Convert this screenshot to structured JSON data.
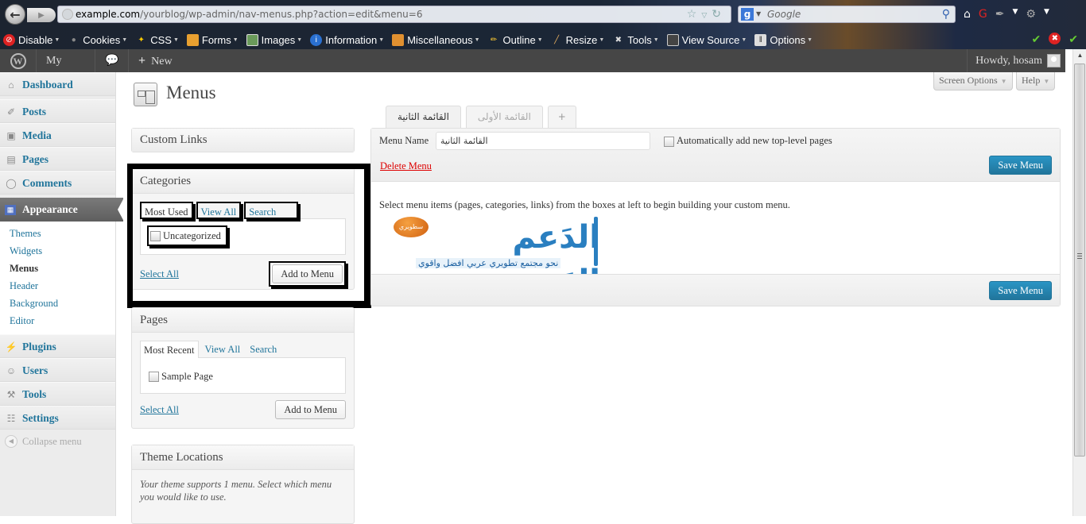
{
  "browser": {
    "url_host": "example.com",
    "url_path": "/yourblog/wp-admin/nav-menus.php?action=edit&menu=6",
    "search_placeholder": "Google",
    "toolbar": [
      {
        "label": "Disable",
        "icon": "disable-icon"
      },
      {
        "label": "Cookies",
        "icon": "cookies-icon"
      },
      {
        "label": "CSS",
        "icon": "css-icon"
      },
      {
        "label": "Forms",
        "icon": "forms-icon"
      },
      {
        "label": "Images",
        "icon": "images-icon"
      },
      {
        "label": "Information",
        "icon": "information-icon"
      },
      {
        "label": "Miscellaneous",
        "icon": "miscellaneous-icon"
      },
      {
        "label": "Outline",
        "icon": "outline-icon"
      },
      {
        "label": "Resize",
        "icon": "resize-icon"
      },
      {
        "label": "Tools",
        "icon": "tools-icon"
      },
      {
        "label": "View Source",
        "icon": "view-source-icon"
      },
      {
        "label": "Options",
        "icon": "options-icon"
      }
    ]
  },
  "adminbar": {
    "blog_name": "My Blog",
    "new_label": "New",
    "howdy": "Howdy, hosam"
  },
  "sidebar": {
    "top_items": [
      {
        "label": "Dashboard",
        "icon": "dashboard-icon"
      },
      {
        "label": "Posts",
        "icon": "posts-icon"
      },
      {
        "label": "Media",
        "icon": "media-icon"
      },
      {
        "label": "Pages",
        "icon": "pages-icon"
      },
      {
        "label": "Comments",
        "icon": "comments-icon"
      },
      {
        "label": "Appearance",
        "icon": "appearance-icon"
      }
    ],
    "submenu": [
      "Themes",
      "Widgets",
      "Menus",
      "Header",
      "Background",
      "Editor"
    ],
    "bottom_items": [
      {
        "label": "Plugins",
        "icon": "plugins-icon"
      },
      {
        "label": "Users",
        "icon": "users-icon"
      },
      {
        "label": "Tools",
        "icon": "tools-icon"
      },
      {
        "label": "Settings",
        "icon": "settings-icon"
      }
    ],
    "collapse_label": "Collapse menu"
  },
  "screen_options": "Screen Options",
  "help": "Help",
  "page_title": "Menus",
  "custom_links": {
    "title": "Custom Links"
  },
  "categories": {
    "title": "Categories",
    "tabs": [
      "Most Used",
      "View All",
      "Search"
    ],
    "items": [
      "Uncategorized"
    ],
    "select_all": "Select All",
    "add_button": "Add to Menu"
  },
  "pages_box": {
    "title": "Pages",
    "tabs": [
      "Most Recent",
      "View All",
      "Search"
    ],
    "items": [
      "Sample Page"
    ],
    "select_all": "Select All",
    "add_button": "Add to Menu"
  },
  "theme_locations": {
    "title": "Theme Locations",
    "text": "Your theme supports 1 menu. Select which menu you would like to use."
  },
  "menu_tabs": [
    "القائمة الثانية",
    "القائمة الأولى",
    "+"
  ],
  "menu_edit": {
    "name_label": "Menu Name",
    "name_value": "القائمة الثانية",
    "auto_add_label": "Automatically add new top-level pages",
    "delete_label": "Delete Menu",
    "save_label": "Save Menu",
    "instructions": "Select menu items (pages, categories, links) from the boxes at left to begin building your custom menu."
  },
  "logo": {
    "main": "الدَعم العَربي",
    "bubble": "سطويري",
    "tagline": "نحو مجتمع تطويري عربي افضل واقوي"
  }
}
